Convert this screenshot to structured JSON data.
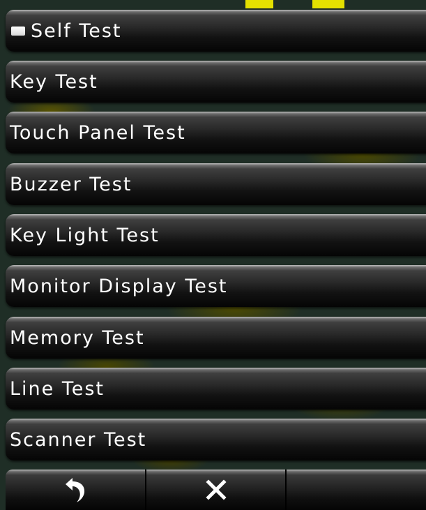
{
  "menu": {
    "items": [
      {
        "label": "Self Test",
        "icon": "checkbox-icon"
      },
      {
        "label": "Key Test"
      },
      {
        "label": "Touch Panel Test"
      },
      {
        "label": "Buzzer Test"
      },
      {
        "label": "Key Light Test"
      },
      {
        "label": "Monitor Display Test"
      },
      {
        "label": "Memory Test"
      },
      {
        "label": "Line Test"
      },
      {
        "label": "Scanner Test"
      }
    ]
  },
  "toolbar": {
    "buttons": [
      {
        "icon": "back-arrow-icon"
      },
      {
        "icon": "close-icon"
      },
      {
        "icon": ""
      }
    ]
  },
  "colors": {
    "button_text": "#ffffff",
    "map_background": "#1f2e26",
    "map_land": "#4f4c00",
    "map_highlight": "#e4e000"
  }
}
